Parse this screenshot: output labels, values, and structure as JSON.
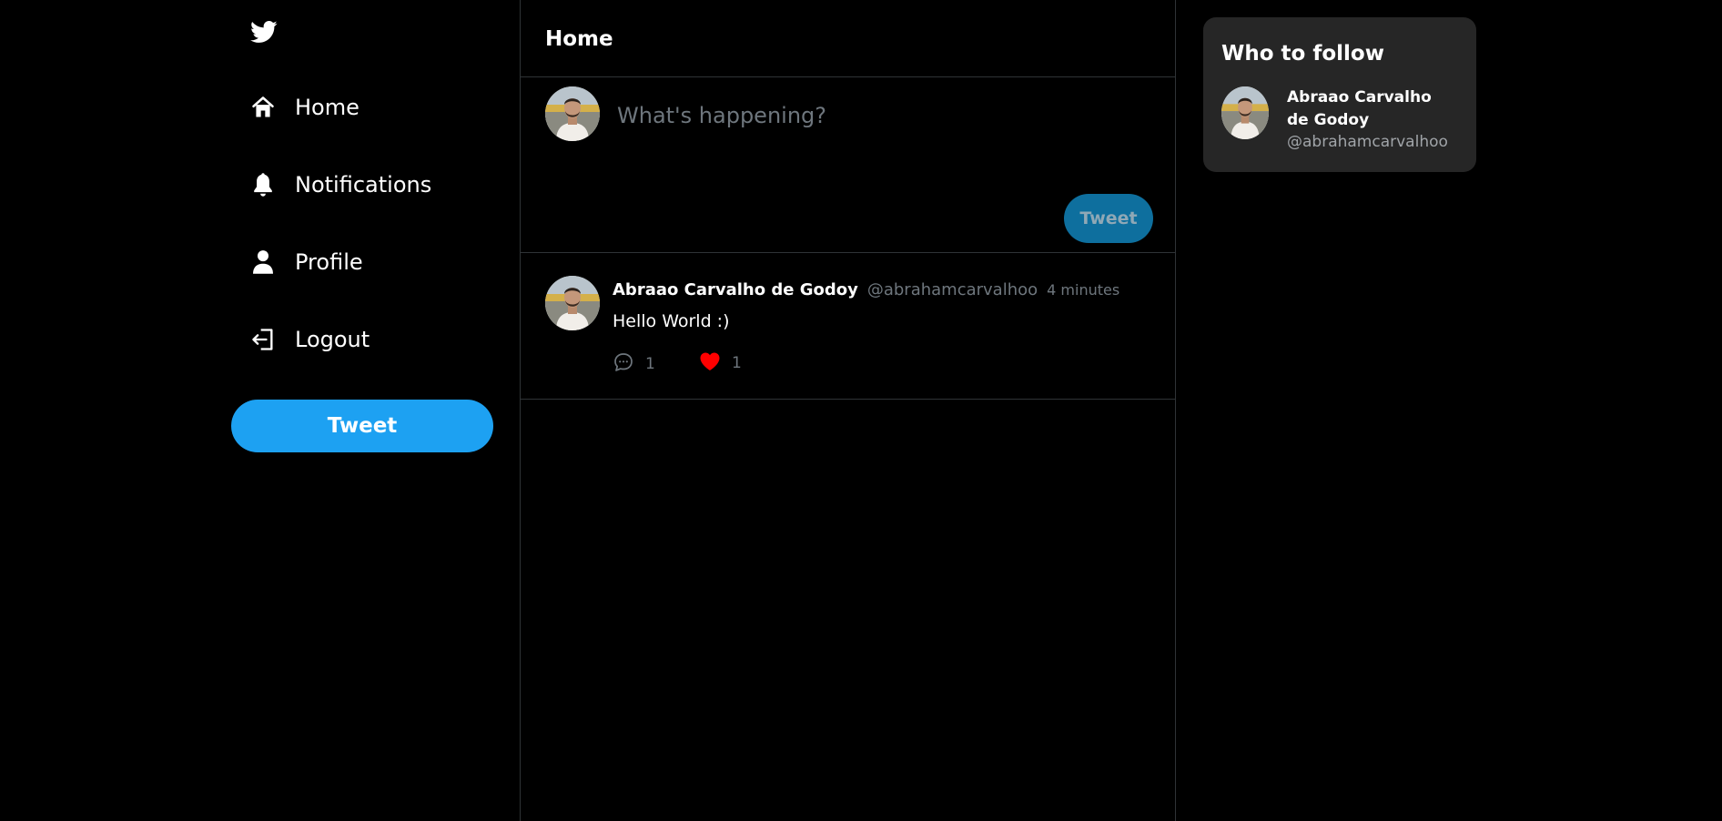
{
  "app": {
    "logo": "twitter-bird-icon",
    "accent_color": "#1da1f2",
    "background_color": "#000000"
  },
  "sidebar": {
    "items": [
      {
        "label": "Home",
        "icon": "home-icon"
      },
      {
        "label": "Notifications",
        "icon": "bell-icon"
      },
      {
        "label": "Profile",
        "icon": "user-icon"
      },
      {
        "label": "Logout",
        "icon": "logout-icon"
      }
    ],
    "tweet_button": "Tweet"
  },
  "main": {
    "title": "Home",
    "composer": {
      "placeholder": "What's happening?",
      "button": "Tweet"
    },
    "tweets": [
      {
        "author": "Abraao Carvalho de Godoy",
        "handle": "@abrahamcarvalhoo",
        "time": "4 minutes",
        "text": "Hello World :)",
        "comments": "1",
        "likes": "1",
        "liked": true,
        "like_color": "#ff0000"
      }
    ]
  },
  "who_to_follow": {
    "title": "Who to follow",
    "users": [
      {
        "name": "Abraao Carvalho de Godoy",
        "handle": "@abrahamcarvalhoo"
      }
    ]
  }
}
